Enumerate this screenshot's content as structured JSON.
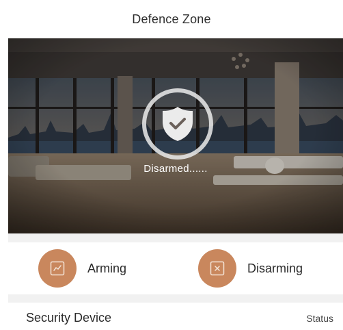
{
  "header": {
    "title": "Defence Zone"
  },
  "hero": {
    "status_text": "Disarmed......",
    "status_icon": "shield-check-icon"
  },
  "actions": [
    {
      "label": "Arming",
      "icon": "arm-icon"
    },
    {
      "label": "Disarming",
      "icon": "disarm-icon"
    }
  ],
  "security_device": {
    "title": "Security Device",
    "status_label": "Status"
  },
  "colors": {
    "accent": "#c9875d",
    "shield": "#ebebeb"
  }
}
